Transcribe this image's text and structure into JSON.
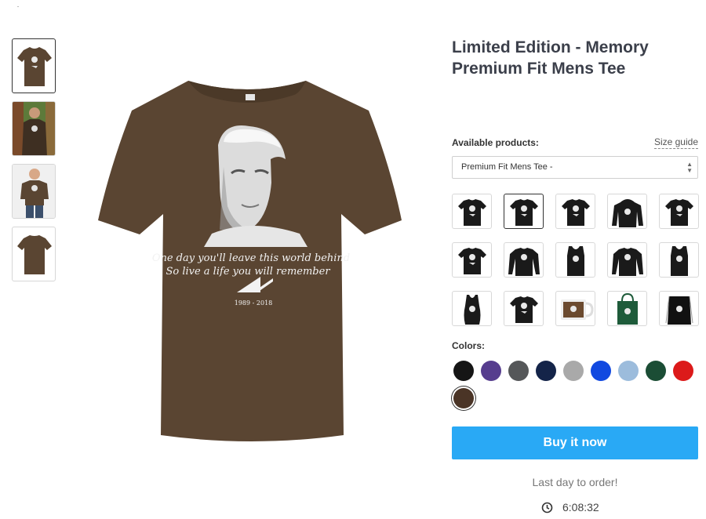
{
  "product": {
    "title": "Limited Edition - Memory Premium Fit Mens Tee",
    "design_text_line1": "One day you'll leave this world behind",
    "design_text_line2": "So live a life you will remember",
    "design_years": "1989 - 2018"
  },
  "thumbnails": [
    {
      "name": "thumb-front",
      "active": true
    },
    {
      "name": "thumb-model-street",
      "active": false
    },
    {
      "name": "thumb-model-studio",
      "active": false
    },
    {
      "name": "thumb-back",
      "active": false
    }
  ],
  "available_products": {
    "label": "Available products:",
    "size_guide": "Size guide",
    "selected": "Premium Fit Mens Tee -",
    "variants": [
      {
        "name": "classic-tee",
        "type": "tee",
        "color": "#1a1a1a",
        "active": false
      },
      {
        "name": "premium-tee",
        "type": "tee",
        "color": "#1a1a1a",
        "active": true
      },
      {
        "name": "ladies-tee",
        "type": "tee",
        "color": "#1a1a1a",
        "active": false
      },
      {
        "name": "hoodie",
        "type": "hoodie",
        "color": "#1a1a1a",
        "active": false
      },
      {
        "name": "youth-tee",
        "type": "tee",
        "color": "#1a1a1a",
        "active": false
      },
      {
        "name": "v-neck",
        "type": "tee",
        "color": "#1a1a1a",
        "active": false
      },
      {
        "name": "long-sleeve",
        "type": "longsleeve",
        "color": "#1a1a1a",
        "active": false
      },
      {
        "name": "tank-top",
        "type": "tank",
        "color": "#1a1a1a",
        "active": false
      },
      {
        "name": "sweatshirt",
        "type": "longsleeve",
        "color": "#1a1a1a",
        "active": false
      },
      {
        "name": "womens-tank",
        "type": "tank",
        "color": "#1a1a1a",
        "active": false
      },
      {
        "name": "racerback-tank",
        "type": "racerback",
        "color": "#1a1a1a",
        "active": false
      },
      {
        "name": "ladies-v-neck",
        "type": "tee",
        "color": "#1a1a1a",
        "active": false
      },
      {
        "name": "mug",
        "type": "mug",
        "color": "#6b4a2f",
        "active": false
      },
      {
        "name": "tote-bag",
        "type": "tote",
        "color": "#1e5b3a",
        "active": false
      },
      {
        "name": "drawstring-bag",
        "type": "drawstring",
        "color": "#111111",
        "active": false
      }
    ]
  },
  "colors": {
    "label": "Colors:",
    "swatches": [
      {
        "name": "black",
        "hex": "#151515"
      },
      {
        "name": "purple",
        "hex": "#563d8e"
      },
      {
        "name": "charcoal",
        "hex": "#555759"
      },
      {
        "name": "navy",
        "hex": "#142449"
      },
      {
        "name": "heather-grey",
        "hex": "#a9a9a9"
      },
      {
        "name": "royal-blue",
        "hex": "#1149e0"
      },
      {
        "name": "light-blue",
        "hex": "#9cbcdc"
      },
      {
        "name": "forest-green",
        "hex": "#1b4d35"
      },
      {
        "name": "red",
        "hex": "#dc1a1a"
      },
      {
        "name": "brown",
        "hex": "#4a3426",
        "selected": true
      }
    ]
  },
  "buy_button": "Buy it now",
  "last_day": "Last day to order!",
  "countdown": "6:08:32",
  "shirt_color": "#5a4532"
}
